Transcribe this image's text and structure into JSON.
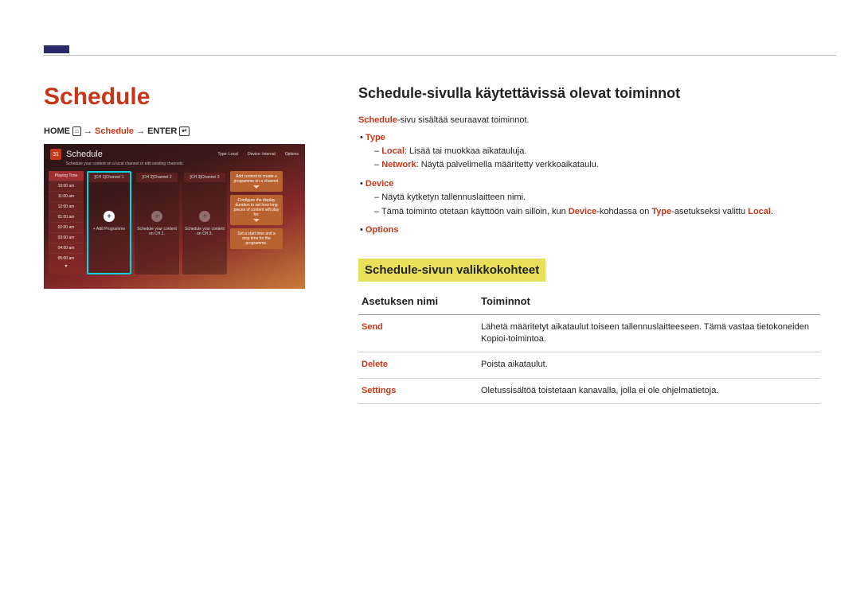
{
  "page_title": "Schedule",
  "breadcrumb": {
    "home": "HOME",
    "arrow": " → ",
    "schedule": "Schedule",
    "enter": "ENTER"
  },
  "screenshot": {
    "cal_day": "31",
    "title": "Schedule",
    "top_right": [
      "Type: Local",
      "Device: Internal",
      "Options"
    ],
    "subtitle": "Schedule your content on a local channel or edit existing channels.",
    "time_header": "Playing Time",
    "times": [
      "10:00 am",
      "11:00 am",
      "12:00 am",
      "01:00 am",
      "02:00 am",
      "03:00 am",
      "04:00 am",
      "05:00 am"
    ],
    "channels": [
      {
        "hd": "[CH 1]Channel 1",
        "lbl": "+ Add Programme",
        "sel": true,
        "dim": false
      },
      {
        "hd": "[CH 2]Channel 2",
        "lbl": "Schedule your content on CH 2.",
        "sel": false,
        "dim": true
      },
      {
        "hd": "[CH 3]Channel 3",
        "lbl": "Schedule your content on CH 3.",
        "sel": false,
        "dim": true
      }
    ],
    "cards": [
      "Add content to create a programme on a channel.",
      "Configure the display duration to set how long pieces of content will play for.",
      "Set a start time and a stop time for the programme."
    ]
  },
  "right": {
    "heading_functions": "Schedule-sivulla käytettävissä olevat toiminnot",
    "intro_pre": "Schedule",
    "intro_post": "-sivu sisältää seuraavat toiminnot.",
    "items": {
      "type": {
        "label": "Type",
        "sub": [
          {
            "kw": "Local",
            "text": ": Lisää tai muokkaa aikatauluja."
          },
          {
            "kw": "Network",
            "text": ": Näytä palvelimella määritetty verkkoaikataulu."
          }
        ]
      },
      "device": {
        "label": "Device",
        "sub_plain": "Näytä kytketyn tallennuslaitteen nimi.",
        "sub_note_pre": "Tämä toiminto otetaan käyttöön vain silloin, kun ",
        "sub_note_device": "Device",
        "sub_note_mid": "-kohdassa on ",
        "sub_note_type": "Type",
        "sub_note_mid2": "-asetukseksi valittu ",
        "sub_note_local": "Local",
        "sub_note_end": "."
      },
      "options": {
        "label": "Options"
      }
    },
    "menu_heading": "Schedule-sivun valikkokohteet",
    "table": {
      "col_name": "Asetuksen nimi",
      "col_func": "Toiminnot",
      "rows": [
        {
          "name": "Send",
          "func": "Lähetä määritetyt aikataulut toiseen tallennuslaitteeseen. Tämä vastaa tietokoneiden Kopioi-toimintoa."
        },
        {
          "name": "Delete",
          "func": "Poista aikataulut."
        },
        {
          "name": "Settings",
          "func": "Oletussisältöä toistetaan kanavalla, jolla ei ole ohjelmatietoja."
        }
      ]
    }
  }
}
